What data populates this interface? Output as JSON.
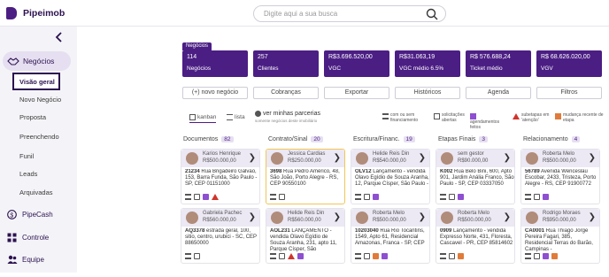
{
  "app": {
    "name": "Pipeimob"
  },
  "search": {
    "placeholder": "Digite aqui a sua busca"
  },
  "sidebar": {
    "section_label": "Negócios",
    "subitems": [
      "Visão geral",
      "Novo Negócio",
      "Proposta",
      "Preenchendo",
      "Funil",
      "Leads",
      "Arquivadas"
    ],
    "nav": [
      "PipeCash",
      "Controle",
      "Equipe"
    ]
  },
  "panel": {
    "tag": "Negócios",
    "stats": [
      {
        "value": "114",
        "label": "Negócios"
      },
      {
        "value": "257",
        "label": "Clientes"
      },
      {
        "value": "R$3.696.520,00",
        "label": "VGC"
      },
      {
        "value": "R$31.063,19",
        "label": "VGC médio 6.5%"
      },
      {
        "value": "R$ 576.688,24",
        "label": "Ticket médio"
      },
      {
        "value": "R$ 68.626.020,00",
        "label": "VGV"
      }
    ],
    "actions": [
      "(+) novo negócio",
      "Cobranças",
      "Exportar",
      "Históricos",
      "Agenda",
      "Filtros"
    ],
    "view": {
      "kanban": "kanban",
      "lista": "lista",
      "parcerias": "ver minhas parcerias",
      "parcerias_hint": "somente negócios deste imobiliário",
      "legend": [
        "com ou sem financiamento",
        "solicitações abertas",
        "agendamentos feitos",
        "subetapas em 'atenção'",
        "mudança recente de etapa"
      ]
    },
    "columns": [
      {
        "title": "Documentos",
        "count": "82",
        "cards": [
          {
            "name": "Karios Henrique",
            "price": "R$500.000,00",
            "code": "21234",
            "text": "Rua Brigadeiro Galvão, 153, Barra Funda, São Paulo - SP, CEP 01151000",
            "icons": [
              "bank",
              "doc",
              "cal",
              "warn"
            ],
            "hl": false
          },
          {
            "name": "Gabriela Pachec",
            "price": "R$560.000,00",
            "code": "AQ3378",
            "text": "estrada geral, 100, sitio, centro, urubici - SC, CEP 88650000",
            "icons": [
              "bank",
              "doc"
            ],
            "hl": false
          }
        ]
      },
      {
        "title": "Contrato/Sinal",
        "count": "20",
        "cards": [
          {
            "name": "Jessica Cardias",
            "price": "R$250.000,00",
            "code": "3698",
            "text": "Rua Pedro Américo, 48, São João, Porto Alegre - RS, CEP 90550100",
            "icons": [
              "bank",
              "doc"
            ],
            "hl": true
          },
          {
            "name": "Helide Reis Din",
            "price": "R$560.000,00",
            "code": "AOL231",
            "text": "LANÇAMENTO - vendida Olavo Egídio de Souza Aranha, 231, apto 11, Parque Císper, São",
            "icons": [
              "bank",
              "doc",
              "warn",
              "cal"
            ],
            "hl": false
          }
        ]
      },
      {
        "title": "Escritura/Financ.",
        "count": "19",
        "cards": [
          {
            "name": "Helide Reis Din",
            "price": "R$540.000,00",
            "code": "OLV12",
            "text": "Lançamento - vendida Olavo Egídio de Souza Aranha, 12, Parque Císper, São Paulo -",
            "icons": [
              "bank",
              "doc",
              "cal"
            ],
            "hl": false
          },
          {
            "name": "Roberta Melo",
            "price": "R$500.000,00",
            "code": "10203040",
            "text": "Rua Rio Tocantins, 1549, Apto 61, Residencial Amazonas, Franca - SP, CEP",
            "icons": [
              "bank",
              "doc",
              "tag",
              "cal"
            ],
            "hl": false
          }
        ]
      },
      {
        "title": "Etapas Finais",
        "count": "3",
        "cards": [
          {
            "name": "sem gestor",
            "price": "R$90.000,00",
            "code": "K002",
            "text": "Rua Belo Bini, 600, Apto 901, Jardim Anália Franco, São Paulo - SP, CEP 03337050",
            "icons": [
              "bank",
              "doc",
              "cal"
            ],
            "hl": false
          },
          {
            "name": "Roberta Melo",
            "price": "R$500.000,00",
            "code": "0909",
            "text": "Lançamento - vendida Expresso Norte, 431, Floresta, Cascavel - PR, CEP 85814602",
            "icons": [
              "bank",
              "doc",
              "tag"
            ],
            "hl": false
          }
        ]
      },
      {
        "title": "Relacionamento",
        "count": "4",
        "cards": [
          {
            "name": "Roberta Melo",
            "price": "R$500.000,00",
            "code": "56789",
            "text": "Avenida Wenceslau Escobar, 2433, Tristeza, Porto Alegre - RS, CEP 91900772",
            "icons": [
              "bank",
              "doc",
              "cal"
            ],
            "hl": false
          },
          {
            "name": "Rodrigo Moraes",
            "price": "R$950.000,00",
            "code": "CA0001",
            "text": "Rua Thiago Jorge Pereira Fagari, 385, Residencial Terras do Barão, Campinas -",
            "icons": [
              "bank",
              "doc",
              "cal",
              "tag"
            ],
            "hl": false
          }
        ]
      }
    ]
  }
}
